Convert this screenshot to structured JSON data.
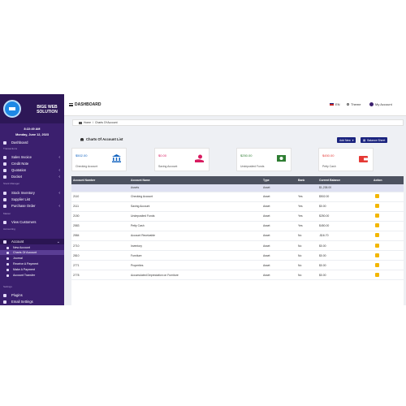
{
  "sidebar": {
    "brand": "BIGE WEB SOLUTION",
    "time": "8:22:49 AM",
    "date": "Monday, June 12, 2023",
    "dashboard": "Dashboard",
    "sections": [
      "Transactions",
      "Stock Manager",
      "Master",
      "Accounting",
      "Settings"
    ],
    "items": {
      "sales_invoice": "Sales Invoice",
      "credit_note": "Credit Note",
      "quotation": "Quotation",
      "docket": "Docket",
      "stock_inventory": "Stock Inventory",
      "supplier_list": "Supplier List",
      "purchase_order": "Purchase Order",
      "view_customers": "View Customers",
      "account": "Account",
      "plugins": "Plugins",
      "email_settings": "Email Settings"
    },
    "account_sub": [
      "New Account",
      "Charts Of Account",
      "Journal",
      "Receive A Payment",
      "Make A Payment",
      "Account Transfer"
    ]
  },
  "topbar": {
    "title": "DASHBOARD",
    "lang": "EN",
    "theme": "Theme",
    "account": "My Account"
  },
  "breadcrumb": {
    "home": "Home",
    "current": "Charts Of Account"
  },
  "page": {
    "title": "Charts Of Account List",
    "add_new": "Add New",
    "balance_sheet": "Balance Sheet"
  },
  "cards": [
    {
      "amount": "$502.00",
      "name": "Checking Account",
      "color": "#1565c0"
    },
    {
      "amount": "$0.00",
      "name": "Saving Account",
      "color": "#d81b60"
    },
    {
      "amount": "$250.00",
      "name": "Undeposited Funds",
      "color": "#2e7d32"
    },
    {
      "amount": "$450.00",
      "name": "Petty Cash",
      "color": "#e53935"
    }
  ],
  "table": {
    "headers": [
      "Account Number",
      "Account Name",
      "Type",
      "Bank",
      "Current Balance",
      "Action"
    ],
    "group": {
      "name": "Assets",
      "type": "Asset",
      "balance": "$1,238.00"
    },
    "rows": [
      [
        "2110",
        "Checking Account",
        "Asset",
        "Yes",
        "$502.00"
      ],
      [
        "2111",
        "Saving Account",
        "Asset",
        "Yes",
        "$0.00"
      ],
      [
        "2150",
        "Undeposited Funds",
        "Asset",
        "Yes",
        "$250.00"
      ],
      [
        "2583",
        "Petty Cash",
        "Asset",
        "Yes",
        "$450.00"
      ],
      [
        "2584",
        "Account Receivable",
        "Asset",
        "No",
        "-$16.70"
      ],
      [
        "2710",
        "Inventory",
        "Asset",
        "No",
        "$0.00"
      ],
      [
        "2810",
        "Furniture",
        "Asset",
        "No",
        "$0.00"
      ],
      [
        "2771",
        "Properties",
        "Asset",
        "No",
        "$0.00"
      ],
      [
        "2778",
        "Accumulated Depreciation on Furniture",
        "Asset",
        "No",
        "$0.00"
      ]
    ]
  }
}
